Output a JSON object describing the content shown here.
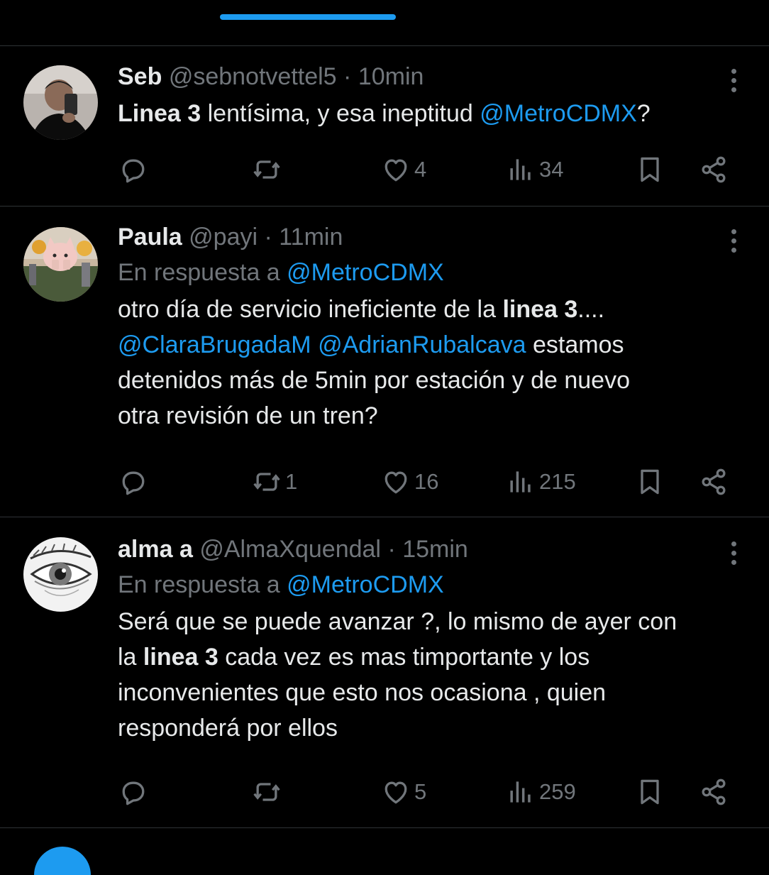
{
  "tweets": [
    {
      "name": "Seb",
      "handle": "@sebnotvettel5",
      "time": "10min",
      "reply_prefix": "",
      "reply_to": "",
      "body": [
        {
          "bold": "Linea 3"
        },
        {
          "text": " lentísima, y esa ineptitud "
        },
        {
          "mention": "@MetroCDMX"
        },
        {
          "text": "?"
        }
      ],
      "stats": {
        "retweets": "",
        "likes": "4",
        "views": "34"
      }
    },
    {
      "name": "Paula",
      "handle": "@payi",
      "time": "11min",
      "reply_prefix": "En respuesta a ",
      "reply_to": "@MetroCDMX",
      "body": [
        {
          "text": "otro día de servicio ineficiente de la "
        },
        {
          "bold": "linea 3"
        },
        {
          "text": "...."
        },
        {
          "br": true
        },
        {
          "mention": "@ClaraBrugadaM"
        },
        {
          "text": " "
        },
        {
          "mention": "@AdrianRubalcava"
        },
        {
          "text": " estamos"
        },
        {
          "br": true
        },
        {
          "text": "detenidos más de 5min por estación y de nuevo"
        },
        {
          "br": true
        },
        {
          "text": "otra revisión de un tren?"
        }
      ],
      "stats": {
        "retweets": "1",
        "likes": "16",
        "views": "215"
      }
    },
    {
      "name": "alma a",
      "handle": "@AlmaXquendal",
      "time": "15min",
      "reply_prefix": "En respuesta a ",
      "reply_to": "@MetroCDMX",
      "body": [
        {
          "text": "Será que se puede avanzar ?, lo mismo de ayer con"
        },
        {
          "br": true
        },
        {
          "text": "la "
        },
        {
          "bold": "linea 3"
        },
        {
          "text": " cada vez es mas timportante y los"
        },
        {
          "br": true
        },
        {
          "text": "inconvenientes  que esto nos ocasiona , quien"
        },
        {
          "br": true
        },
        {
          "text": "responderá por ellos"
        }
      ],
      "stats": {
        "retweets": "",
        "likes": "5",
        "views": "259"
      }
    }
  ],
  "icons": {
    "reply": "reply-icon",
    "retweet": "retweet-icon",
    "like": "heart-icon",
    "views": "views-icon",
    "bookmark": "bookmark-icon",
    "share": "share-icon",
    "more": "more-icon"
  },
  "colors": {
    "background": "#000000",
    "text": "#e7e9ea",
    "muted": "#71767b",
    "accent": "#1d9bf0",
    "divider": "#2f3336"
  }
}
